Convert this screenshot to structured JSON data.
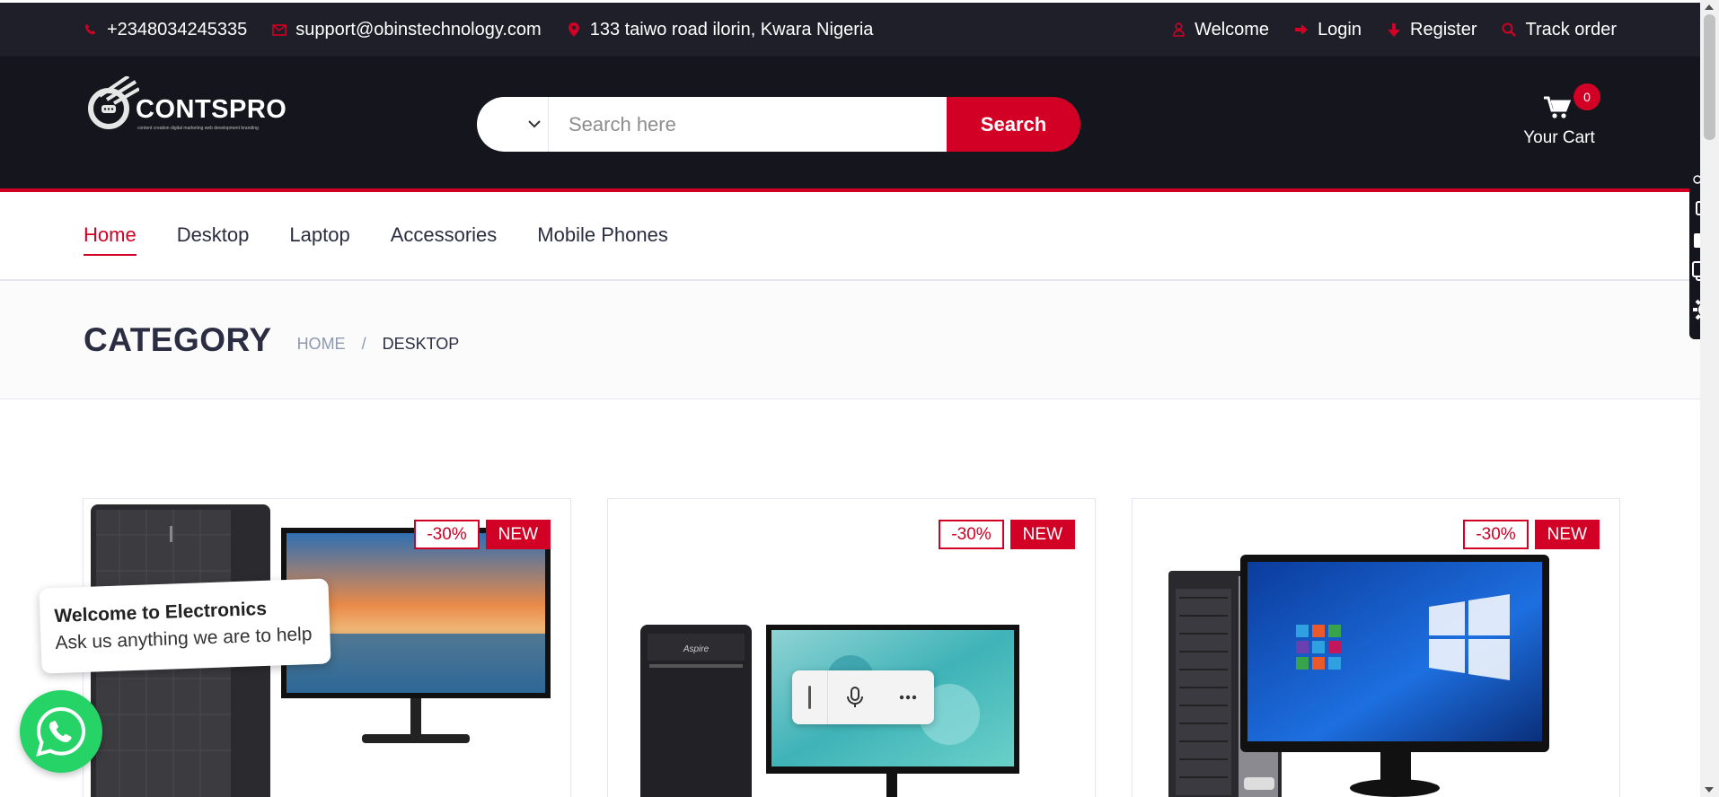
{
  "topbar": {
    "phone": "+2348034245335",
    "email": "support@obinstechnology.com",
    "address": "133 taiwo road ilorin, Kwara Nigeria",
    "welcome": "Welcome",
    "login": "Login",
    "register": "Register",
    "track_order": "Track order"
  },
  "logo": {
    "text": "CONTSPRO",
    "tagline": "content creation  digital marketing  web development  branding"
  },
  "search": {
    "category_selected": "",
    "placeholder": "Search here",
    "button_label": "Search"
  },
  "cart": {
    "count": "0",
    "label": "Your Cart"
  },
  "nav": {
    "items": [
      "Home",
      "Desktop",
      "Laptop",
      "Accessories",
      "Mobile Phones"
    ],
    "active": "Home"
  },
  "breadcrumb": {
    "title": "CATEGORY",
    "home": "HOME",
    "separator": "/",
    "current": "DESKTOP"
  },
  "products": [
    {
      "sale": "-30%",
      "badge": "NEW"
    },
    {
      "sale": "-30%",
      "badge": "NEW"
    },
    {
      "sale": "-30%",
      "badge": "NEW"
    }
  ],
  "chat": {
    "title": "Welcome to Electronics",
    "subtitle": "Ask us anything we are to help"
  },
  "colors": {
    "accent": "#d10024",
    "header_dark": "#15161d",
    "topbar_dark": "#1e1f29",
    "whatsapp": "#25d366"
  },
  "icons": {
    "phone": "phone-icon",
    "email": "envelope-icon",
    "address": "map-marker-icon",
    "welcome": "user-icon",
    "login": "sign-in-icon",
    "register": "arrow-down-icon",
    "track": "search-icon",
    "cart": "shopping-cart-icon",
    "whatsapp": "whatsapp-icon"
  }
}
